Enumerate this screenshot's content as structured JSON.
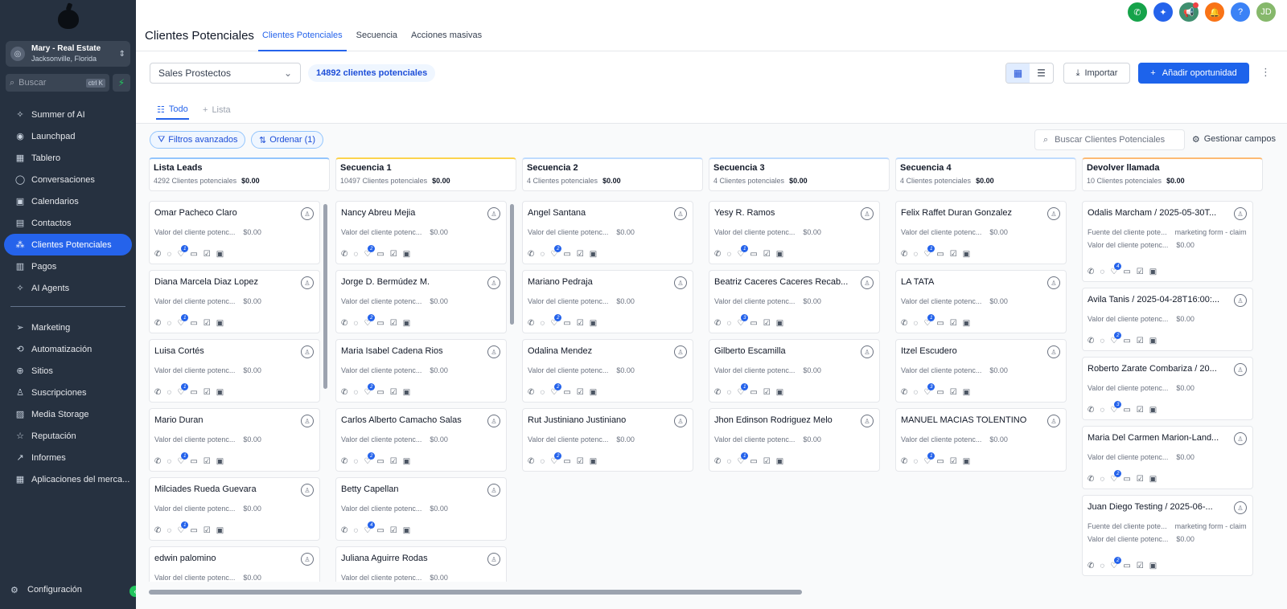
{
  "sidebar": {
    "account_name": "Mary - Real Estate",
    "account_location": "Jacksonville, Florida",
    "search_placeholder": "Buscar",
    "search_shortcut": "ctrl K",
    "items": [
      {
        "label": "Summer of AI",
        "icon": "sparkle-icon"
      },
      {
        "label": "Launchpad",
        "icon": "rocket-icon"
      },
      {
        "label": "Tablero",
        "icon": "dashboard-icon"
      },
      {
        "label": "Conversaciones",
        "icon": "chat-icon"
      },
      {
        "label": "Calendarios",
        "icon": "calendar-icon"
      },
      {
        "label": "Contactos",
        "icon": "contacts-icon"
      },
      {
        "label": "Clientes Potenciales",
        "icon": "funnel-icon",
        "active": true
      },
      {
        "label": "Pagos",
        "icon": "payments-icon"
      },
      {
        "label": "AI Agents",
        "icon": "ai-icon"
      }
    ],
    "items2": [
      {
        "label": "Marketing",
        "icon": "send-icon"
      },
      {
        "label": "Automatización",
        "icon": "automation-icon"
      },
      {
        "label": "Sitios",
        "icon": "globe-icon"
      },
      {
        "label": "Suscripciones",
        "icon": "membership-icon"
      },
      {
        "label": "Media Storage",
        "icon": "image-icon"
      },
      {
        "label": "Reputación",
        "icon": "star-icon"
      },
      {
        "label": "Informes",
        "icon": "chart-icon"
      },
      {
        "label": "Aplicaciones del merca...",
        "icon": "apps-icon"
      }
    ],
    "settings_label": "Configuración"
  },
  "header": {
    "title": "Clientes Potenciales",
    "tabs": [
      "Clientes Potenciales",
      "Secuencia",
      "Acciones masivas"
    ],
    "user_initials": "JD",
    "help_label": "?"
  },
  "toolbar": {
    "pipeline": "Sales Prostectos",
    "count": "14892 clientes potenciales",
    "import_label": "Importar",
    "add_label": "Añadir oportunidad"
  },
  "subtabs": {
    "all": "Todo",
    "list": "Lista"
  },
  "filters": {
    "advanced": "Filtros avanzados",
    "sort": "Ordenar (1)",
    "search_placeholder": "Buscar Clientes Potenciales",
    "manage_fields": "Gestionar campos"
  },
  "colors": {
    "accent": "#2563eb",
    "sidebar": "#263140"
  },
  "card_value_label": "Valor del cliente potenc...",
  "card_value": "$0.00",
  "columns": [
    {
      "title": "Lista Leads",
      "count": "4292 Clientes potenciales",
      "amount": "$0.00",
      "color": "#93c5fd",
      "cards": [
        "Omar Pacheco Claro",
        "Diana Marcela Diaz Lopez",
        "Luisa Cortés",
        "Mario Duran",
        "Milciades Rueda Guevara",
        "edwin palomino"
      ],
      "badges": [
        "1",
        "1",
        "1",
        "1",
        "1",
        ""
      ]
    },
    {
      "title": "Secuencia 1",
      "count": "10497 Clientes potenciales",
      "amount": "$0.00",
      "color": "#fcd34d",
      "cards": [
        "Nancy Abreu Mejia",
        "Jorge D. Bermúdez M.",
        "Maria Isabel Cadena Rios",
        "Carlos Alberto Camacho Salas",
        "Betty Capellan",
        "Juliana Aguirre Rodas"
      ],
      "badges": [
        "2",
        "2",
        "2",
        "2",
        "4",
        ""
      ]
    },
    {
      "title": "Secuencia 2",
      "count": "4 Clientes potenciales",
      "amount": "$0.00",
      "color": "#bfdbfe",
      "cards": [
        "Angel Santana",
        "Mariano Pedraja",
        "Odalina Mendez",
        "Rut Justiniano Justiniano"
      ],
      "badges": [
        "2",
        "2",
        "2",
        "2"
      ]
    },
    {
      "title": "Secuencia 3",
      "count": "4 Clientes potenciales",
      "amount": "$0.00",
      "color": "#bfdbfe",
      "cards": [
        "Yesy R. Ramos",
        "Beatriz Caceres Caceres Recab...",
        "Gilberto Escamilla",
        "Jhon Edinson Rodriguez Melo"
      ],
      "badges": [
        "1",
        "3",
        "1",
        "1"
      ]
    },
    {
      "title": "Secuencia 4",
      "count": "4 Clientes potenciales",
      "amount": "$0.00",
      "color": "#bfdbfe",
      "cards": [
        "Felix Raffet Duran Gonzalez",
        "LA TATA",
        "Itzel Escudero",
        "MANUEL MACIAS TOLENTINO"
      ],
      "badges": [
        "1",
        "1",
        "3",
        "1"
      ]
    },
    {
      "title": "Devolver llamada",
      "count": "10 Clientes potenciales",
      "amount": "$0.00",
      "color": "#fdba74",
      "cards": [
        "Odalis Marcham / 2025-05-30T...",
        "Avila Tanis / 2025-04-28T16:00:...",
        "Roberto Zarate Combariza / 20...",
        "Maria Del Carmen Marion-Land...",
        "Juan Diego Testing / 2025-06-..."
      ],
      "badges": [
        "4",
        "2",
        "3",
        "2",
        "2"
      ]
    }
  ],
  "source_label": "Fuente del cliente pote...",
  "source_value": "marketing form - claim"
}
